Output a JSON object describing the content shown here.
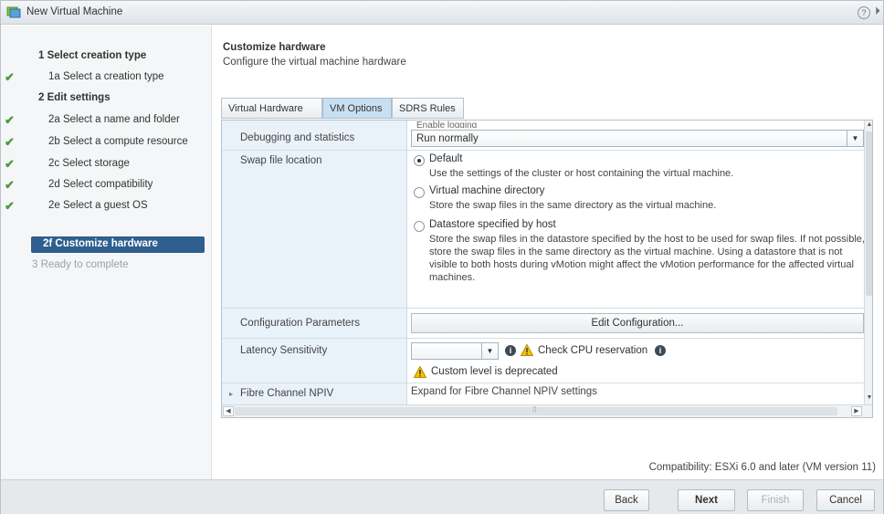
{
  "window": {
    "title": "New Virtual Machine",
    "help_glyph": "?",
    "collapse_glyph": "⏵"
  },
  "sidebar": {
    "items": [
      {
        "label": "1  Select creation type",
        "kind": "step",
        "done": false
      },
      {
        "label": "1a  Select a creation type",
        "kind": "sub",
        "done": true
      },
      {
        "label": "2  Edit settings",
        "kind": "step",
        "done": false
      },
      {
        "label": "2a  Select a name and folder",
        "kind": "sub",
        "done": true
      },
      {
        "label": "2b  Select a compute resource",
        "kind": "sub",
        "done": true
      },
      {
        "label": "2c  Select storage",
        "kind": "sub",
        "done": true
      },
      {
        "label": "2d  Select compatibility",
        "kind": "sub",
        "done": true
      },
      {
        "label": "2e  Select a guest OS",
        "kind": "sub",
        "done": true
      },
      {
        "label": "2f  Customize hardware",
        "kind": "current",
        "done": false
      },
      {
        "label": "3  Ready to complete",
        "kind": "disabled",
        "done": false
      }
    ],
    "check_glyph": "✔"
  },
  "main": {
    "title": "Customize hardware",
    "subtitle": "Configure the virtual machine hardware",
    "tabs": [
      {
        "label": "Virtual Hardware",
        "active": false
      },
      {
        "label": "VM Options",
        "active": true
      },
      {
        "label": "SDRS Rules",
        "active": false
      }
    ],
    "cut_off_text": "Enable logging",
    "rows": {
      "debugging": {
        "label": "Debugging and statistics",
        "value": "Run normally"
      },
      "swap": {
        "label": "Swap file location",
        "options": [
          {
            "title": "Default",
            "desc": "Use the settings of the cluster or host containing the virtual machine.",
            "checked": true
          },
          {
            "title": "Virtual machine directory",
            "desc": "Store the swap files in the same directory as the virtual machine.",
            "checked": false
          },
          {
            "title": "Datastore specified by host",
            "desc": "Store the swap files in the datastore specified by the host to be used for swap files. If not possible, store the swap files in the same directory as the virtual machine. Using a datastore that is not visible to both hosts during vMotion might affect the vMotion performance for the affected virtual machines.",
            "checked": false
          }
        ]
      },
      "config": {
        "label": "Configuration Parameters",
        "button": "Edit Configuration..."
      },
      "latency": {
        "label": "Latency Sensitivity",
        "value": "",
        "check_cpu": "Check CPU reservation",
        "deprecated": "Custom level is deprecated"
      },
      "fibre": {
        "label": "Fibre Channel NPIV",
        "value": "Expand for Fibre Channel NPIV settings"
      }
    },
    "compatibility": "Compatibility: ESXi 6.0 and later (VM version 11)"
  },
  "footer": {
    "back": "Back",
    "next": "Next",
    "finish": "Finish",
    "cancel": "Cancel"
  },
  "colors": {
    "accent": "#2f5f8e",
    "active_tab": "#c8dff1",
    "check_green": "#4c9b3a",
    "warning": "#f2c200"
  }
}
